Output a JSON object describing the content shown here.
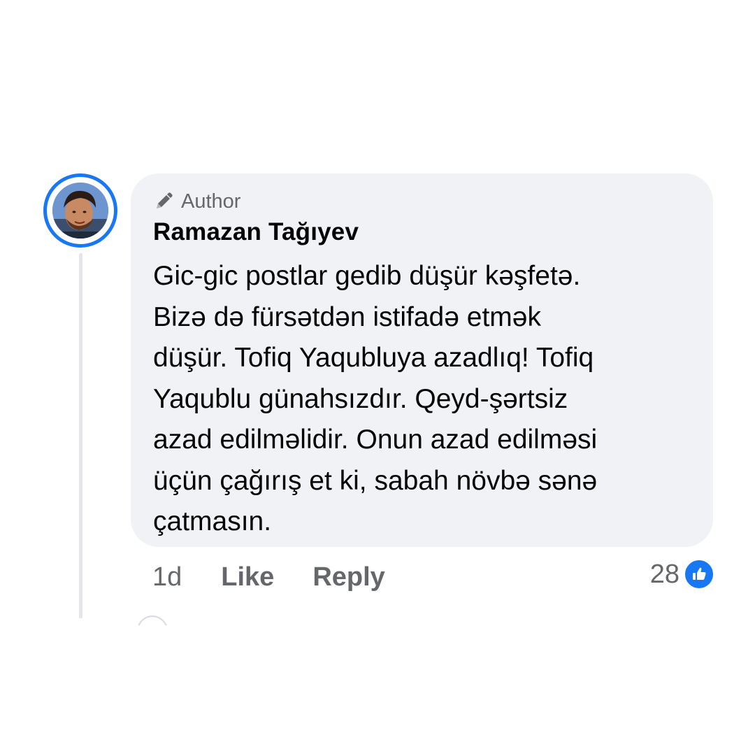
{
  "comment": {
    "badge_label": "Author",
    "badge_icon": "pencil-icon",
    "author_name": "Ramazan Tağıyev",
    "text_lines": [
      "Gic-gic postlar gedib düşür kəşfetə.",
      "Bizə də fürsətdən istifadə etmək",
      "düşür. Tofiq Yaqubluya azadlıq! Tofiq",
      "Yaqublu günahsızdır. Qeyd-şərtsiz",
      "azad edilməlidir. Onun azad edilməsi",
      "üçün çağırış et ki, sabah növbə sənə",
      "çatmasın."
    ],
    "time": "1d",
    "like_label": "Like",
    "reply_label": "Reply",
    "reaction_count": "28",
    "reaction_icon": "thumbs-up-icon"
  },
  "colors": {
    "accent": "#1877f2",
    "bubble_bg": "#f0f2f5",
    "secondary_text": "#65676b",
    "primary_text": "#050505"
  }
}
